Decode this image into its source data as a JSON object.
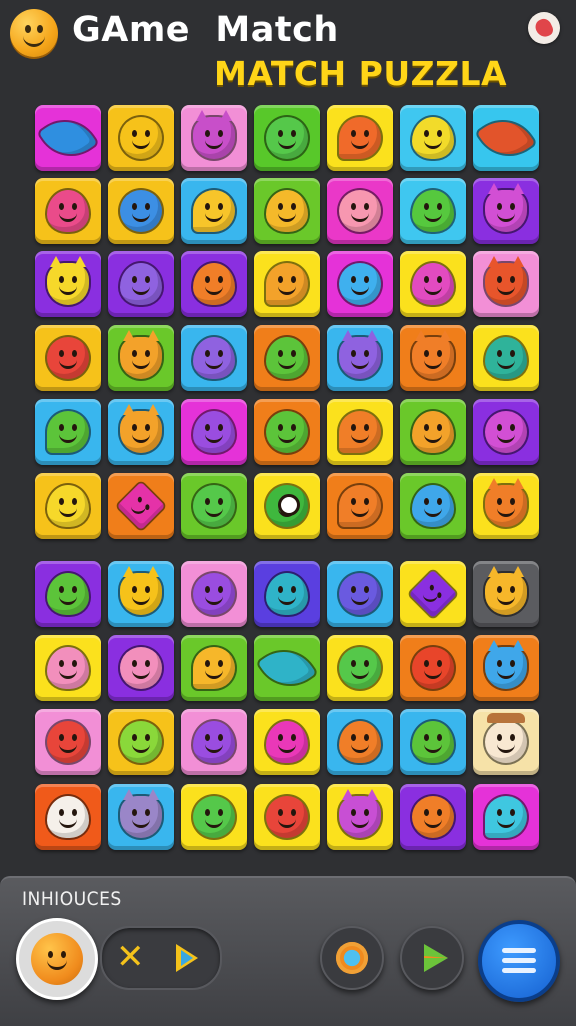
{
  "header": {
    "title_line1": "GAme  Match",
    "title_line2": "MATCH PUZZLA"
  },
  "board": {
    "rows": 10,
    "cols": 7,
    "tiles": [
      [
        {
          "bg": "#e532d8",
          "fg": "#2f8fe0",
          "shape": "rocket"
        },
        {
          "bg": "#f6c21a",
          "fg": "#f6c21a",
          "shape": "round"
        },
        {
          "bg": "#f28fd6",
          "fg": "#c84fc9",
          "shape": "spiky"
        },
        {
          "bg": "#58c82a",
          "fg": "#55c84a",
          "shape": "round"
        },
        {
          "bg": "#fbe11d",
          "fg": "#f06a2a",
          "shape": "bubble"
        },
        {
          "bg": "#3fc7f0",
          "fg": "#f2db2a",
          "shape": "drop"
        },
        {
          "bg": "#37c6ee",
          "fg": "#e2542b",
          "shape": "rocket"
        }
      ],
      [
        {
          "bg": "#f6c21a",
          "fg": "#ea4b8a",
          "shape": "drop"
        },
        {
          "bg": "#f6c21a",
          "fg": "#3c8fe4",
          "shape": "round"
        },
        {
          "bg": "#39b6ee",
          "fg": "#f7c52a",
          "shape": "bubble"
        },
        {
          "bg": "#6ac82a",
          "fg": "#f4b92a",
          "shape": "drop"
        },
        {
          "bg": "#ea38c8",
          "fg": "#f797b0",
          "shape": "round"
        },
        {
          "bg": "#3fc7f0",
          "fg": "#56c83e",
          "shape": "drop"
        },
        {
          "bg": "#8a2fe0",
          "fg": "#d24fd4",
          "shape": "spiky"
        }
      ],
      [
        {
          "bg": "#8a2fe0",
          "fg": "#f6d82a",
          "shape": "spiky"
        },
        {
          "bg": "#8a2fe0",
          "fg": "#8f62e0",
          "shape": "drop"
        },
        {
          "bg": "#8a2fe0",
          "fg": "#f07e28",
          "shape": "drop"
        },
        {
          "bg": "#fbe11d",
          "fg": "#f3a22a",
          "shape": "bubble"
        },
        {
          "bg": "#e532d8",
          "fg": "#3fb0ee",
          "shape": "round"
        },
        {
          "bg": "#fbe11d",
          "fg": "#e24bc0",
          "shape": "drop"
        },
        {
          "bg": "#f28fd6",
          "fg": "#e8552b",
          "shape": "spiky"
        }
      ],
      [
        {
          "bg": "#f6c21a",
          "fg": "#e8453a",
          "shape": "round"
        },
        {
          "bg": "#6ac82a",
          "fg": "#f3a22a",
          "shape": "spiky"
        },
        {
          "bg": "#39b6ee",
          "fg": "#8f62e0",
          "shape": "drop"
        },
        {
          "bg": "#f07e1a",
          "fg": "#5cc43a",
          "shape": "drop"
        },
        {
          "bg": "#39b6ee",
          "fg": "#8f62e0",
          "shape": "spiky"
        },
        {
          "bg": "#f07e1a",
          "fg": "#f07e28",
          "shape": "spiky"
        },
        {
          "bg": "#fbe11d",
          "fg": "#2fb39a",
          "shape": "drop"
        }
      ],
      [
        {
          "bg": "#39b6ee",
          "fg": "#5cc43a",
          "shape": "bubble"
        },
        {
          "bg": "#39b6ee",
          "fg": "#f3a22a",
          "shape": "spiky"
        },
        {
          "bg": "#e532d8",
          "fg": "#9a4de0",
          "shape": "drop"
        },
        {
          "bg": "#f07e1a",
          "fg": "#5cc43a",
          "shape": "round"
        },
        {
          "bg": "#fbe11d",
          "fg": "#f07e28",
          "shape": "bubble"
        },
        {
          "bg": "#6ac82a",
          "fg": "#f3a22a",
          "shape": "drop"
        },
        {
          "bg": "#8a2fe0",
          "fg": "#d24fd4",
          "shape": "round"
        }
      ],
      [
        {
          "bg": "#f6c21a",
          "fg": "#f6d82a",
          "shape": "drop"
        },
        {
          "bg": "#f07e1a",
          "fg": "#e532a8",
          "shape": "star"
        },
        {
          "bg": "#6ac82a",
          "fg": "#55c84a",
          "shape": "round"
        },
        {
          "bg": "#fbe11d",
          "fg": "#3fb83e",
          "shape": "eyeball"
        },
        {
          "bg": "#f07e1a",
          "fg": "#f07e28",
          "shape": "bubble"
        },
        {
          "bg": "#6ac82a",
          "fg": "#3fa7ea",
          "shape": "drop"
        },
        {
          "bg": "#fbe11d",
          "fg": "#f07e28",
          "shape": "spiky"
        }
      ],
      [
        {
          "bg": "#8a2fe0",
          "fg": "#5cc43a",
          "shape": "drop"
        },
        {
          "bg": "#39b6ee",
          "fg": "#f6c21a",
          "shape": "spiky"
        },
        {
          "bg": "#f28fd6",
          "fg": "#9a4de0",
          "shape": "round"
        },
        {
          "bg": "#5a3fe0",
          "fg": "#2fb3c8",
          "shape": "drop"
        },
        {
          "bg": "#39b6ee",
          "fg": "#6a5ae0",
          "shape": "round"
        },
        {
          "bg": "#fbe11d",
          "fg": "#8a2fe0",
          "shape": "star"
        },
        {
          "bg": "#5b5c60",
          "fg": "#f6b72a",
          "shape": "spiky"
        }
      ],
      [
        {
          "bg": "#fbe11d",
          "fg": "#f28fbc",
          "shape": "drop"
        },
        {
          "bg": "#8a2fe0",
          "fg": "#f28fbc",
          "shape": "round"
        },
        {
          "bg": "#6ac82a",
          "fg": "#f6b72a",
          "shape": "bubble"
        },
        {
          "bg": "#6ac82a",
          "fg": "#2fb3c8",
          "shape": "rocket"
        },
        {
          "bg": "#fbe11d",
          "fg": "#55c84a",
          "shape": "round"
        },
        {
          "bg": "#f07e1a",
          "fg": "#e8452a",
          "shape": "round"
        },
        {
          "bg": "#f07e1a",
          "fg": "#3fa7ea",
          "shape": "spiky"
        }
      ],
      [
        {
          "bg": "#f28fd6",
          "fg": "#e8453a",
          "shape": "round"
        },
        {
          "bg": "#f6c21a",
          "fg": "#8ad83a",
          "shape": "round"
        },
        {
          "bg": "#f28fd6",
          "fg": "#9a4de0",
          "shape": "drop"
        },
        {
          "bg": "#fbe11d",
          "fg": "#ea38b8",
          "shape": "drop"
        },
        {
          "bg": "#39b6ee",
          "fg": "#f07e28",
          "shape": "drop"
        },
        {
          "bg": "#39b6ee",
          "fg": "#5cc43a",
          "shape": "drop"
        },
        {
          "bg": "#f6e2a8",
          "fg": "#f8e8d2",
          "shape": "hatted"
        }
      ],
      [
        {
          "bg": "#f05a1a",
          "fg": "#f5f0ea",
          "shape": "drop"
        },
        {
          "bg": "#39b6ee",
          "fg": "#9a86c8",
          "shape": "spiky"
        },
        {
          "bg": "#fbe11d",
          "fg": "#55c84a",
          "shape": "round"
        },
        {
          "bg": "#fbe11d",
          "fg": "#e8453a",
          "shape": "round"
        },
        {
          "bg": "#fbe11d",
          "fg": "#c84fd4",
          "shape": "spiky"
        },
        {
          "bg": "#8a2fe0",
          "fg": "#f07e28",
          "shape": "round"
        },
        {
          "bg": "#e532d8",
          "fg": "#3fc7e0",
          "shape": "bubble"
        }
      ]
    ]
  },
  "bottom_bar": {
    "label": "INHIOUCES",
    "pill_x_glyph": "✕"
  }
}
